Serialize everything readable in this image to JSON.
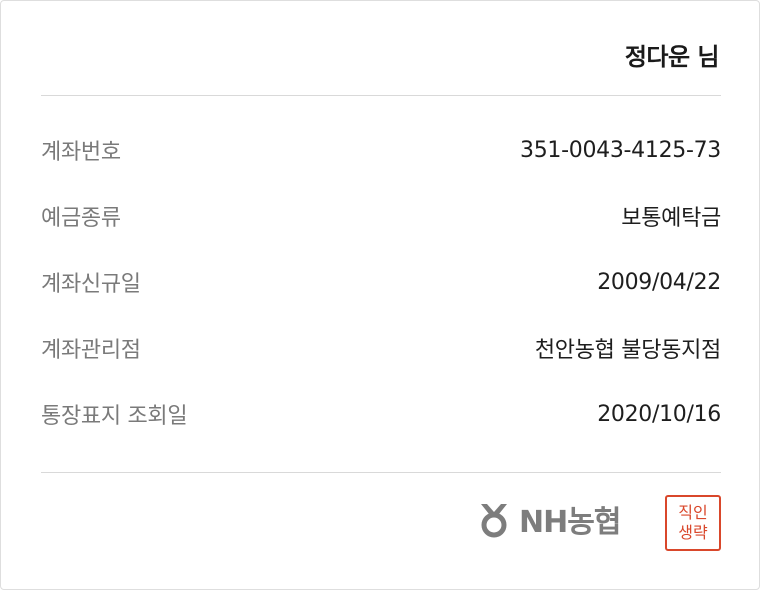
{
  "holder_name": "정다운 님",
  "rows": [
    {
      "label": "계좌번호",
      "value": "351-0043-4125-73"
    },
    {
      "label": "예금종류",
      "value": "보통예탁금"
    },
    {
      "label": "계좌신규일",
      "value": "2009/04/22"
    },
    {
      "label": "계좌관리점",
      "value": "천안농협 불당동지점"
    },
    {
      "label": "통장표지 조회일",
      "value": "2020/10/16"
    }
  ],
  "footer": {
    "logo_text": "NH농협",
    "logo_icon": "nh-bank-logo-icon",
    "seal_line1": "직인",
    "seal_line2": "생략",
    "seal_color": "#d9472b",
    "logo_color": "#7d7d7d"
  }
}
